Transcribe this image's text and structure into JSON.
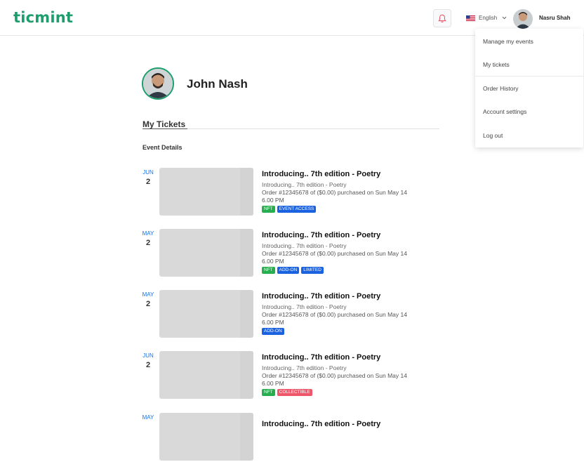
{
  "header": {
    "logo": "ticmint",
    "language": "English",
    "username": "Nasru Shah"
  },
  "menu": {
    "items": [
      {
        "label": "Manage my events"
      },
      {
        "label": "My tickets"
      },
      {
        "label": "Order History"
      },
      {
        "label": "Account settings"
      },
      {
        "label": "Log out"
      }
    ]
  },
  "profile": {
    "name": "John Nash"
  },
  "tickets_section": {
    "title": "My Tickets",
    "subtitle": "Event Details",
    "items": [
      {
        "month": "JUN",
        "day": "2",
        "title": "Introducing.. 7th edition - Poetry",
        "subtitle": "Introducing.. 7th edition - Poetry",
        "order": "Order #12345678 of ($0.00) purchased on Sun May 14 6.00 PM",
        "tags": [
          "NFT",
          "EVENT ACCESS"
        ]
      },
      {
        "month": "MAY",
        "day": "2",
        "title": "Introducing.. 7th edition - Poetry",
        "subtitle": "Introducing.. 7th edition - Poetry",
        "order": "Order #12345678 of ($0.00) purchased on Sun May 14 6.00 PM",
        "tags": [
          "NFT",
          "ADD-ON",
          "LIMITED"
        ]
      },
      {
        "month": "MAY",
        "day": "2",
        "title": "Introducing.. 7th edition - Poetry",
        "subtitle": "Introducing.. 7th edition - Poetry",
        "order": "Order #12345678 of ($0.00) purchased on Sun May 14 6.00 PM",
        "tags": [
          "ADD-ON"
        ]
      },
      {
        "month": "JUN",
        "day": "2",
        "title": "Introducing.. 7th edition - Poetry",
        "subtitle": "Introducing.. 7th edition - Poetry",
        "order": "Order #12345678 of ($0.00) purchased on Sun May 14 6.00 PM",
        "tags": [
          "NFT",
          "COLLECTIBLE"
        ]
      },
      {
        "month": "MAY",
        "day": "",
        "title": "Introducing.. 7th edition - Poetry",
        "subtitle": "",
        "order": "",
        "tags": []
      }
    ]
  },
  "colors": {
    "brand": "#1e9e6d",
    "date_accent": "#1a73e8",
    "tag_green": "#27ae4f",
    "tag_blue": "#1a62e0",
    "tag_red": "#f0566a"
  }
}
